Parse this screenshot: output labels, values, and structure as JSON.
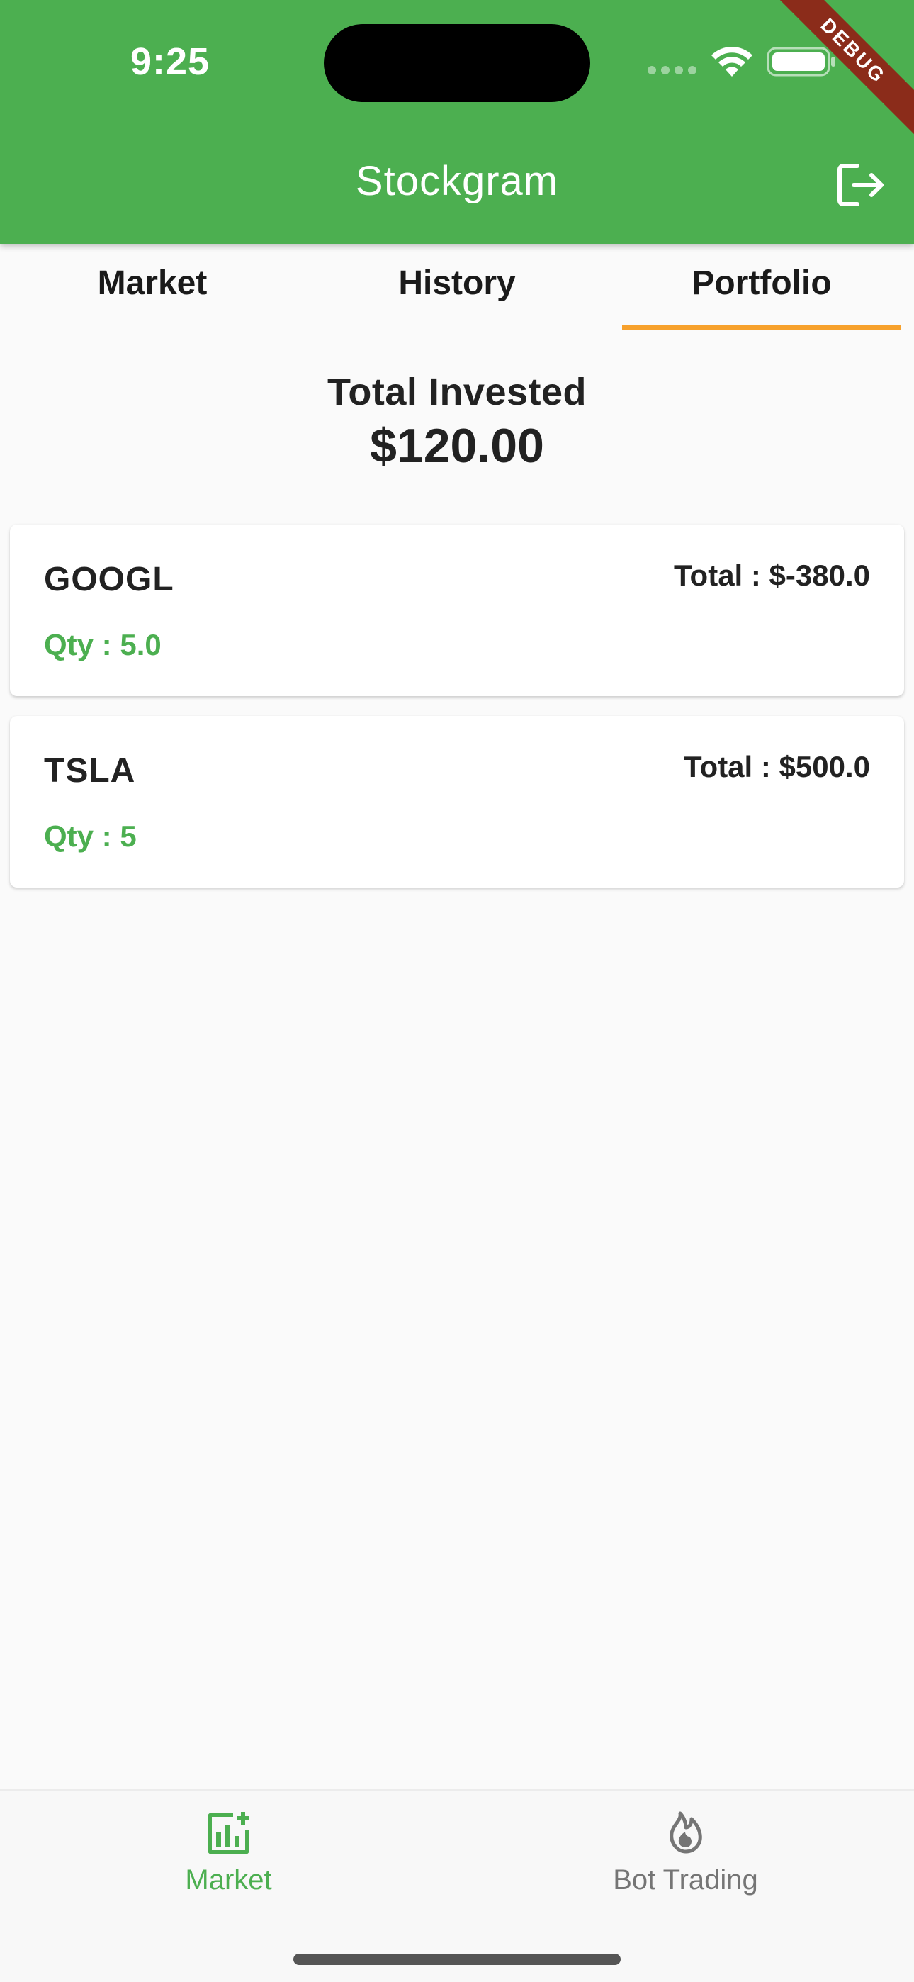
{
  "status_bar": {
    "time": "9:25"
  },
  "debug_banner": "DEBUG",
  "app_bar": {
    "title": "Stockgram",
    "logout_icon": "logout-icon"
  },
  "tabs": [
    {
      "label": "Market",
      "selected": false
    },
    {
      "label": "History",
      "selected": false
    },
    {
      "label": "Portfolio",
      "selected": true
    }
  ],
  "summary": {
    "label": "Total Invested",
    "value": "$120.00"
  },
  "holdings": [
    {
      "symbol": "GOOGL",
      "total": "Total : $-380.0",
      "qty": "Qty : 5.0"
    },
    {
      "symbol": "TSLA",
      "total": "Total : $500.0",
      "qty": "Qty : 5"
    }
  ],
  "bottom_nav": [
    {
      "label": "Market",
      "icon": "chart-add-icon",
      "active": true
    },
    {
      "label": "Bot Trading",
      "icon": "flame-icon",
      "active": false
    }
  ],
  "colors": {
    "primary": "#4caf50",
    "tab_indicator": "#f7a12c",
    "inactive_nav": "#757575",
    "background": "#fafafa"
  }
}
